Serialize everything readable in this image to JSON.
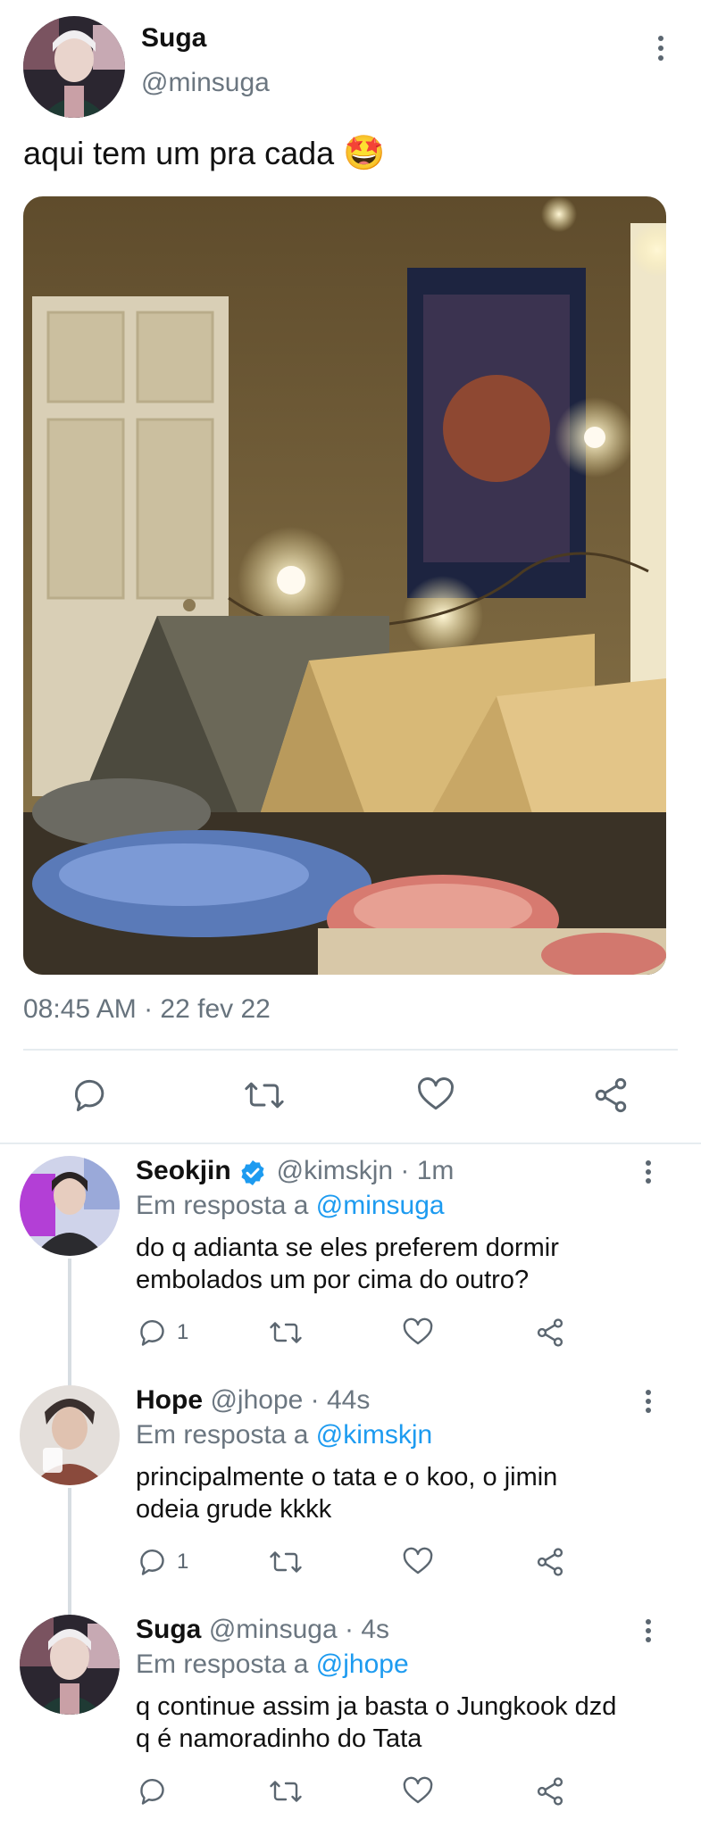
{
  "main_tweet": {
    "author_name": "Suga",
    "author_handle": "@minsuga",
    "text": "aqui tem um pra cada",
    "emoji": "🤩",
    "timestamp": "08:45 AM · 22 fev 22",
    "icons": [
      "reply-icon",
      "retweet-icon",
      "like-icon",
      "share-icon"
    ]
  },
  "replies": [
    {
      "name": "Seokjin",
      "verified": true,
      "handle_time": "@kimskjn · 1m",
      "in_reply_prefix": "Em resposta a",
      "in_reply_to": "@minsuga",
      "text_line1": "do q adianta se eles preferem dormir",
      "text_line2": "embolados um por cima do outro?",
      "reply_count": "1"
    },
    {
      "name": "Hope",
      "verified": false,
      "handle_time": "@jhope · 44s",
      "in_reply_prefix": "Em resposta a",
      "in_reply_to": "@kimskjn",
      "text_line1": "principalmente o tata e o koo, o jimin",
      "text_line2": "odeia grude kkkk",
      "reply_count": "1"
    },
    {
      "name": "Suga",
      "verified": false,
      "handle_time": "@minsuga · 4s",
      "in_reply_prefix": "Em resposta a",
      "in_reply_to": "@jhope",
      "text_line1": "q continue assim ja basta o Jungkook dzd",
      "text_line2": "q é namoradinho do Tata",
      "reply_count": ""
    }
  ],
  "colors": {
    "link": "#1d9bf0",
    "icon": "#5b6670",
    "divider": "#e6ecf0"
  }
}
